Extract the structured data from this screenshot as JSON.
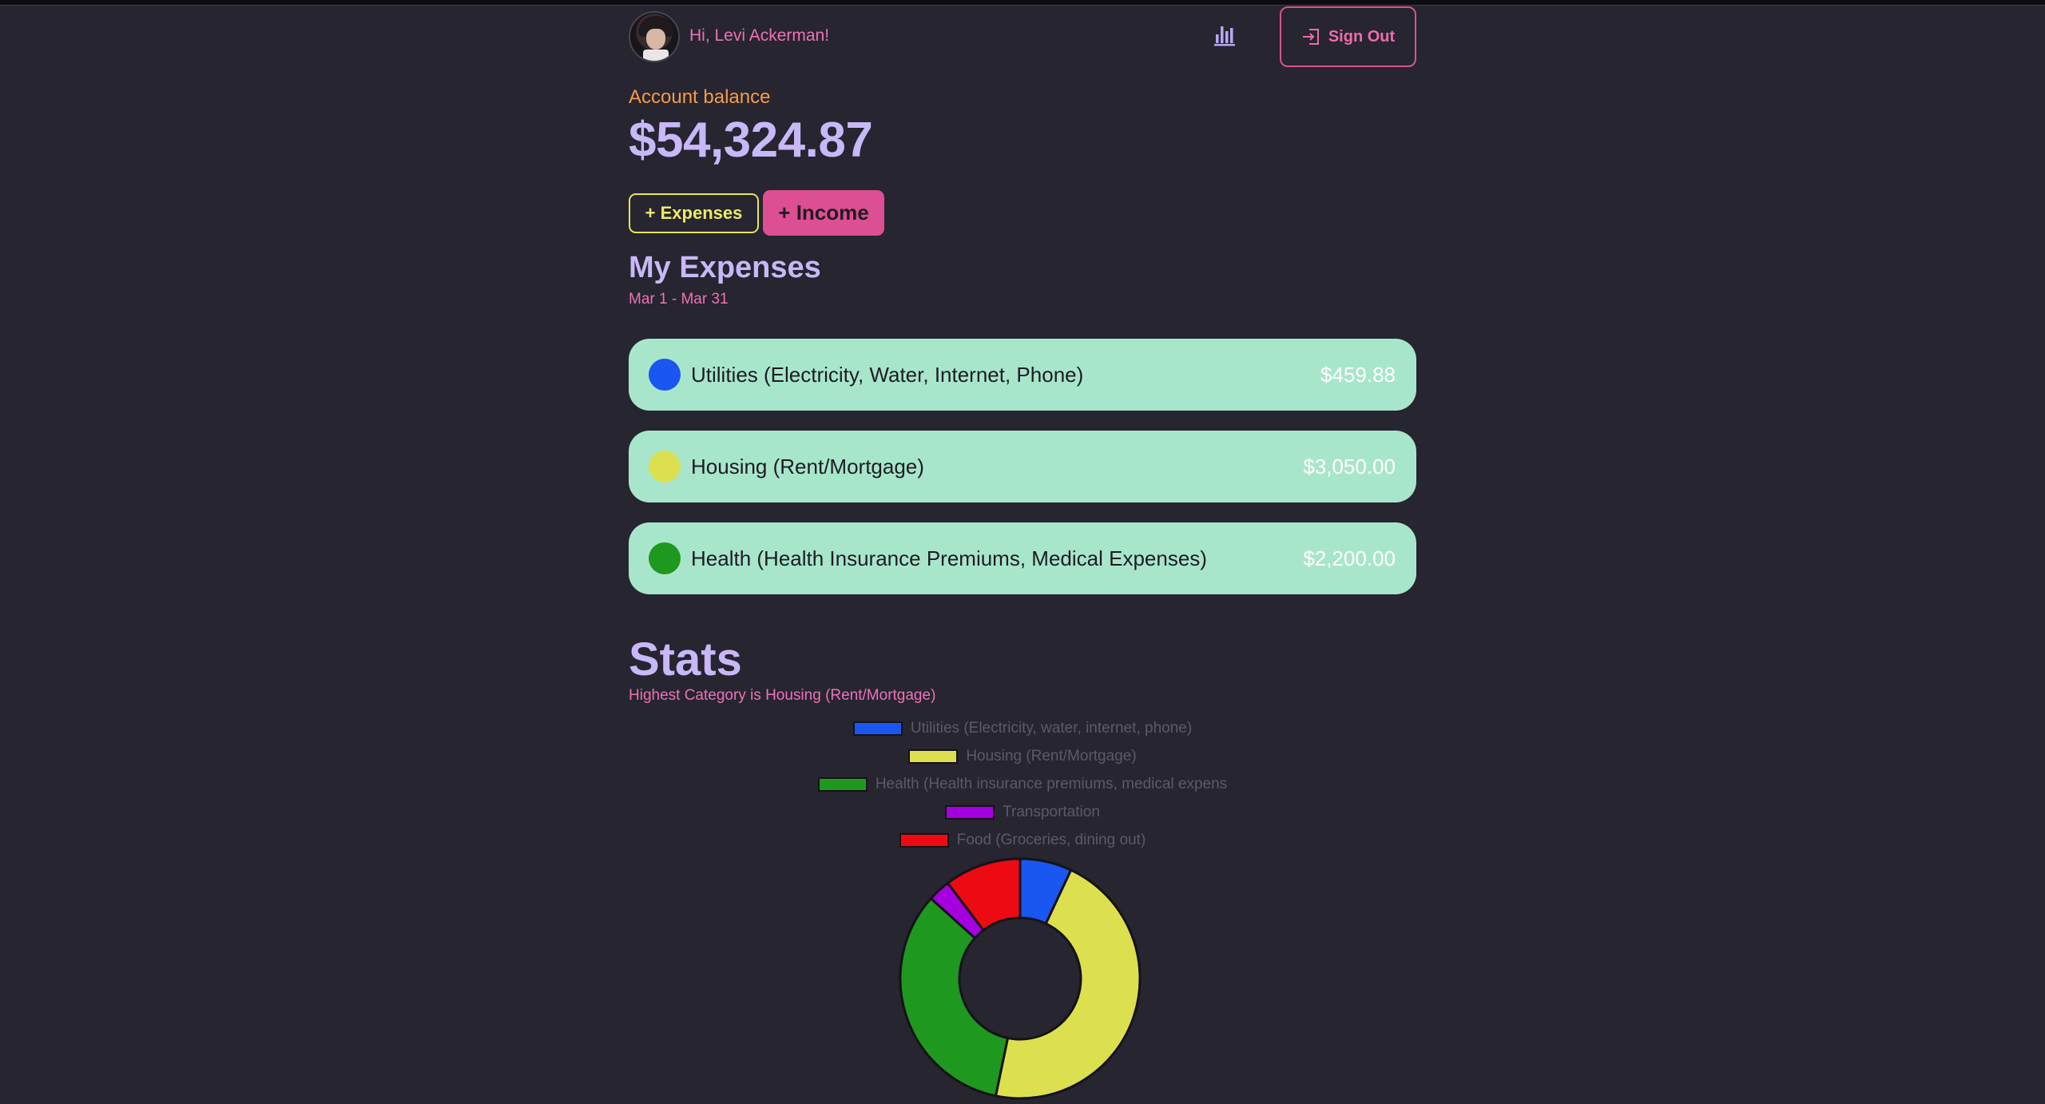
{
  "header": {
    "greeting": "Hi, Levi Ackerman!",
    "sign_out_label": "Sign Out"
  },
  "account": {
    "label": "Account balance",
    "balance": "$54,324.87"
  },
  "actions": {
    "expenses_label": "+ Expenses",
    "income_label": "+ Income"
  },
  "expenses_section": {
    "title": "My Expenses",
    "date_range": "Mar 1 - Mar 31",
    "items": [
      {
        "name": "Utilities (Electricity, Water, Internet, Phone)",
        "amount": "$459.88",
        "color": "#1a56f0"
      },
      {
        "name": "Housing (Rent/Mortgage)",
        "amount": "$3,050.00",
        "color": "#dde04e"
      },
      {
        "name": "Health (Health Insurance Premiums, Medical Expenses)",
        "amount": "$2,200.00",
        "color": "#1f9820"
      }
    ]
  },
  "stats": {
    "title": "Stats",
    "subtitle": "Highest Category is Housing (Rent/Mortgage)"
  },
  "chart_data": {
    "type": "pie",
    "variant": "doughnut",
    "legend_position": "top",
    "categories": [
      "Utilities (Electricity, water, internet, phone)",
      "Housing (Rent/Mortgage)",
      "Health (Health insurance premiums, medical expens",
      "Transportation",
      "Food (Groceries, dining out)"
    ],
    "values": [
      459.88,
      3050.0,
      2200.0,
      200,
      680
    ],
    "colors": [
      "#1a56f0",
      "#dde04e",
      "#1f9820",
      "#a400e0",
      "#ee0a12"
    ]
  }
}
